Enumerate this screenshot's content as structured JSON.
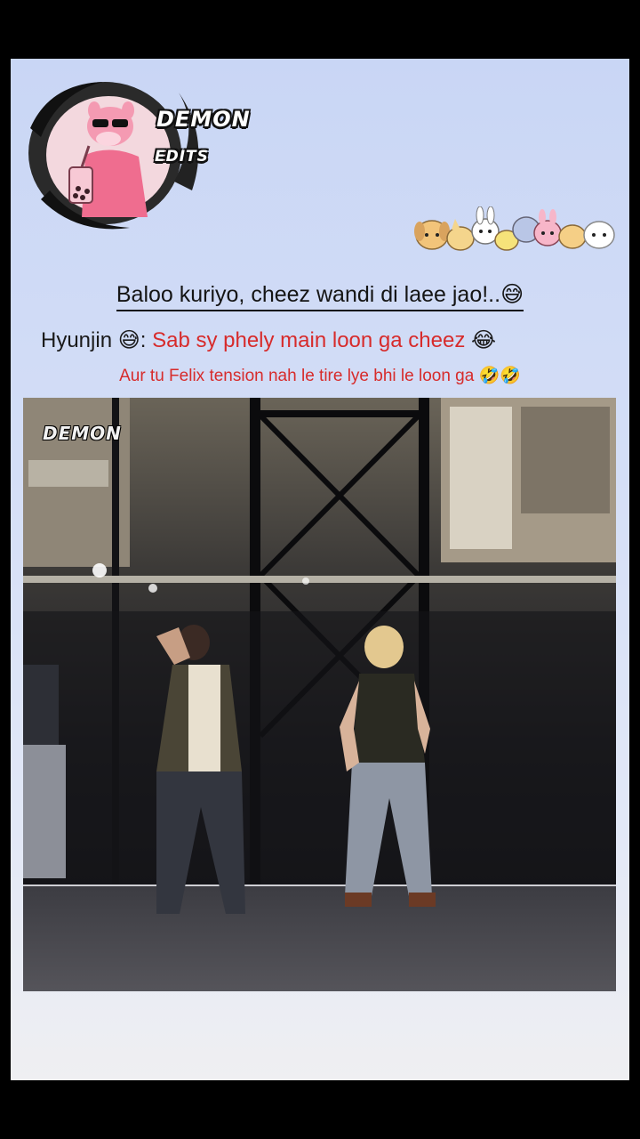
{
  "logo": {
    "title": "DEMON",
    "subtitle": "EDITS",
    "icon": "pink-panther-boba-logo-icon"
  },
  "mascots": {
    "icon": "cute-animal-mascots-icon"
  },
  "caption": {
    "headline": "Baloo kuriyo, cheez wandi di laee jao!..",
    "headline_emoji": "😅",
    "speaker": "Hyunjin",
    "speaker_emoji": "😅",
    "separator": ":",
    "speaker_line": "Sab sy phely main loon ga cheez",
    "speaker_line_emoji": "😂",
    "subline": "Aur tu Felix tension nah le tire lye bhi le loon ga",
    "subline_emoji": "🤣🤣"
  },
  "video": {
    "watermark": "DEMON",
    "icon": "concert-stage-video-icon"
  },
  "colors": {
    "accent_red": "#d72b2b",
    "card_bg": "#c9d6f5"
  }
}
